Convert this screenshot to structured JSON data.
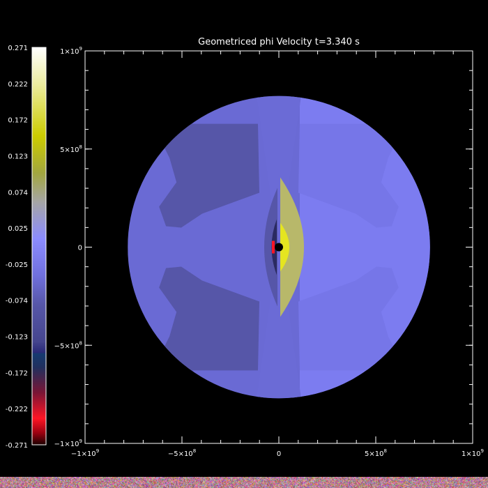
{
  "chart_data": {
    "type": "heatmap",
    "title": "Geometriced phi Velocity t=3.340 s",
    "xlabel": "",
    "ylabel": "",
    "xlim": [
      -1000000000.0,
      1000000000.0
    ],
    "ylim": [
      -1000000000.0,
      1000000000.0
    ],
    "x_ticks": [
      {
        "value": -1000000000.0,
        "base": "−1×10",
        "exp": "9"
      },
      {
        "value": -500000000.0,
        "base": "−5×10",
        "exp": "8"
      },
      {
        "value": 0,
        "base": "0",
        "exp": ""
      },
      {
        "value": 500000000.0,
        "base": "5×10",
        "exp": "8"
      },
      {
        "value": 1000000000.0,
        "base": "1×10",
        "exp": "9"
      }
    ],
    "y_ticks": [
      {
        "value": 1000000000.0,
        "base": "1×10",
        "exp": "9"
      },
      {
        "value": 500000000.0,
        "base": "5×10",
        "exp": "8"
      },
      {
        "value": 0,
        "base": "0",
        "exp": ""
      },
      {
        "value": -500000000.0,
        "base": "−5×10",
        "exp": "8"
      },
      {
        "value": -1000000000.0,
        "base": "−1×10",
        "exp": "9"
      }
    ],
    "colorbar": {
      "range": [
        -0.271,
        0.271
      ],
      "tick_labels": [
        "0.271",
        "0.222",
        "0.172",
        "0.123",
        "0.074",
        "0.025",
        "-0.025",
        "-0.074",
        "-0.123",
        "-0.172",
        "-0.222",
        "-0.271"
      ],
      "stops": [
        {
          "value": 0.271,
          "color": "#ffffff"
        },
        {
          "value": 0.22,
          "color": "#ecec9e"
        },
        {
          "value": 0.15,
          "color": "#cccc00"
        },
        {
          "value": 0.1,
          "color": "#a2a63e"
        },
        {
          "value": 0.06,
          "color": "#a5a5a5"
        },
        {
          "value": 0.01,
          "color": "#8c8cff"
        },
        {
          "value": -0.04,
          "color": "#7070de"
        },
        {
          "value": -0.08,
          "color": "#5656a8"
        },
        {
          "value": -0.13,
          "color": "#45458e"
        },
        {
          "value": -0.145,
          "color": "#2a2a78"
        },
        {
          "value": -0.147,
          "color": "#153a70"
        },
        {
          "value": -0.165,
          "color": "#20305e"
        },
        {
          "value": -0.2,
          "color": "#7a1535"
        },
        {
          "value": -0.235,
          "color": "#ff1525"
        },
        {
          "value": -0.255,
          "color": "#9a0010"
        },
        {
          "value": -0.271,
          "color": "#1a0000"
        }
      ]
    },
    "domain": {
      "shape": "disk",
      "radius": 780000000.0,
      "center": [
        0,
        0
      ]
    },
    "regions": [
      {
        "name": "left-lobe",
        "value": -0.11,
        "color": "#5656a8"
      },
      {
        "name": "left-outer",
        "value": -0.07,
        "color": "#6a6ad4"
      },
      {
        "name": "center-band",
        "value": -0.05,
        "color": "#6b6bd6"
      },
      {
        "name": "right-lobe",
        "value": -0.03,
        "color": "#7676e8"
      },
      {
        "name": "right-outer",
        "value": -0.02,
        "color": "#7c7cf0"
      },
      {
        "name": "jet-positive",
        "value": 0.12,
        "color": "#b8b86a"
      },
      {
        "name": "jet-core",
        "value": 0.17,
        "color": "#e5e520"
      },
      {
        "name": "jet-negative",
        "value": -0.15,
        "color": "#2a2a60"
      },
      {
        "name": "jet-min",
        "value": -0.24,
        "color": "#ff1525"
      },
      {
        "name": "central-object",
        "value": 0,
        "color": "#000000"
      }
    ]
  }
}
